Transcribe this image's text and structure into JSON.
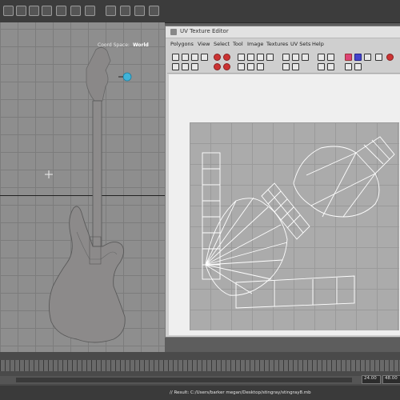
{
  "viewport": {
    "coord_space_label": "Coord Space:",
    "coord_space_value": "World"
  },
  "uv_editor": {
    "title": "UV Texture Editor",
    "menu": [
      "Polygons",
      "View",
      "Select",
      "Tool",
      "Image",
      "Textures",
      "UV Sets",
      "Help"
    ]
  },
  "timeline": {
    "end_frame_a": "24.00",
    "end_frame_b": "48.00"
  },
  "command_line": {
    "result": "// Result: C:/Users/barker megan/Desktop/stingray/stingray8.mb"
  }
}
